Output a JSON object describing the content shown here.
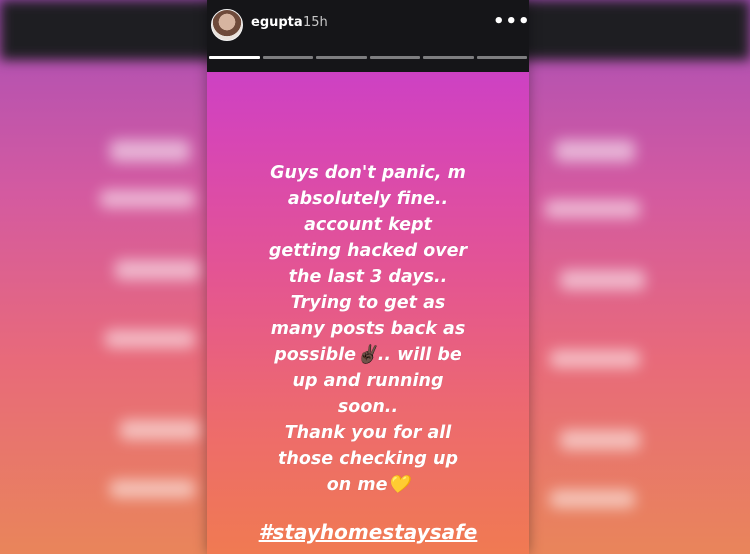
{
  "story": {
    "username": "egupta",
    "time": "15h",
    "more_icon": "more-dots-icon",
    "segments_total": 6,
    "segments_viewed": 1,
    "message_lines": [
      "Guys don't panic, m",
      "absolutely fine..",
      "account kept",
      "getting hacked over",
      "the last 3 days..",
      "Trying to get as",
      "many posts back as",
      "possible✌🏿.. will be",
      "up and running",
      "soon..",
      "Thank you for all",
      "those checking up",
      "on me💛"
    ],
    "hashtag": "#stayhomestaysafe"
  },
  "colors": {
    "header_bg": "#151518",
    "gradient_top": "#c23cd3",
    "gradient_bottom": "#f07a52",
    "text": "#ffffff"
  }
}
